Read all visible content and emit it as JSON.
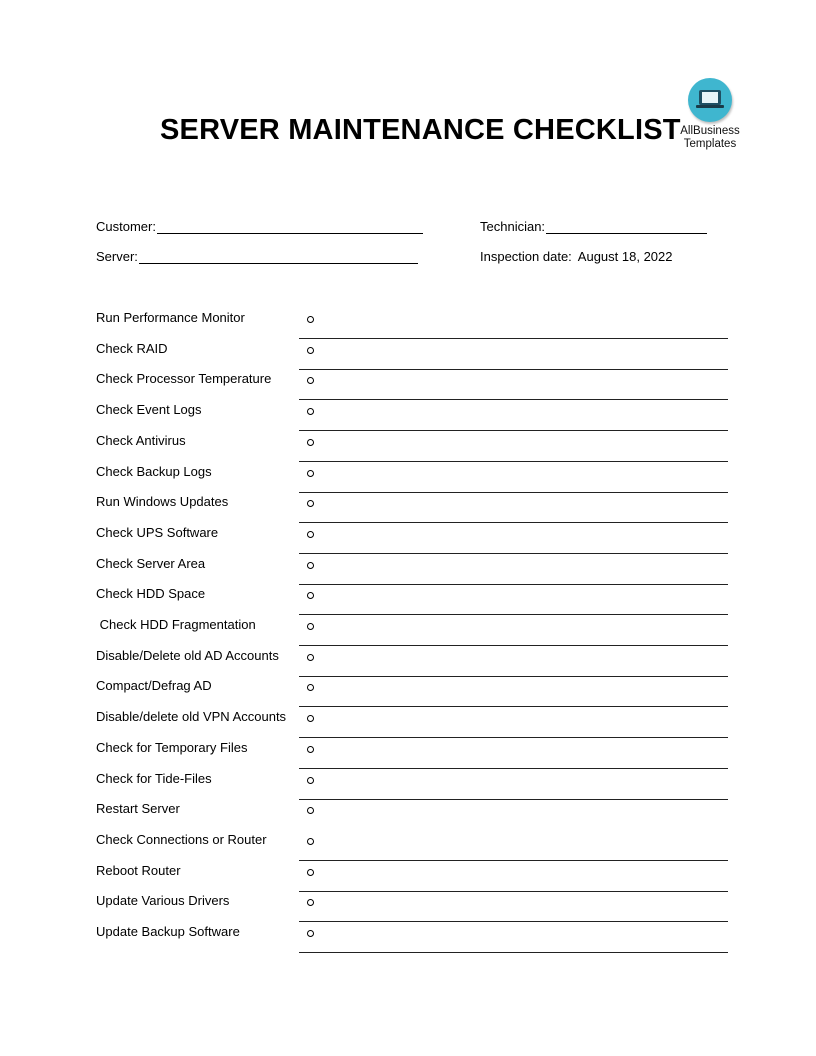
{
  "document": {
    "title": "SERVER MAINTENANCE CHECKLIST",
    "logo": {
      "icon": "laptop-icon",
      "line1": "AllBusiness",
      "line2": "Templates",
      "color": "#3fb6cf"
    }
  },
  "fields": {
    "customer_label": "Customer:",
    "customer_value": "",
    "technician_label": "Technician:",
    "technician_value": "",
    "server_label": "Server:",
    "server_value": "",
    "inspection_label": "Inspection date:",
    "inspection_value": "August 18, 2022"
  },
  "checklist": [
    {
      "label": "Run Performance Monitor",
      "checked": false
    },
    {
      "label": "Check RAID",
      "checked": false
    },
    {
      "label": "Check Processor Temperature",
      "checked": false
    },
    {
      "label": "Check Event Logs",
      "checked": false
    },
    {
      "label": "Check Antivirus",
      "checked": false
    },
    {
      "label": "Check Backup Logs",
      "checked": false
    },
    {
      "label": "Run Windows Updates",
      "checked": false
    },
    {
      "label": "Check UPS Software",
      "checked": false
    },
    {
      "label": "Check Server Area",
      "checked": false
    },
    {
      "label": "Check HDD Space",
      "checked": false
    },
    {
      "label": " Check HDD Fragmentation",
      "checked": false
    },
    {
      "label": "Disable/Delete old AD Accounts",
      "checked": false
    },
    {
      "label": "Compact/Defrag AD",
      "checked": false
    },
    {
      "label": "Disable/delete old VPN Accounts",
      "checked": false
    },
    {
      "label": "Check for Temporary Files",
      "checked": false
    },
    {
      "label": "Check for Tide-Files",
      "checked": false
    },
    {
      "label": "Restart Server",
      "checked": false
    },
    {
      "label": "Check Connections or Router",
      "checked": false
    },
    {
      "label": "Reboot Router",
      "checked": false
    },
    {
      "label": "Update Various Drivers",
      "checked": false
    },
    {
      "label": "Update Backup Software",
      "checked": false
    }
  ]
}
